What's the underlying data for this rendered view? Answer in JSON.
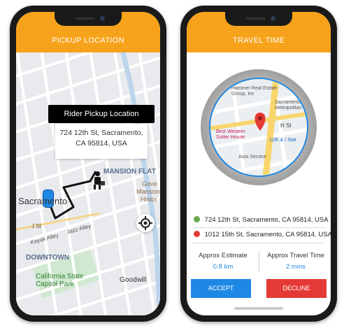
{
  "left_screen": {
    "header_title": "PICKUP LOCATION",
    "callout": {
      "title": "Rider Pickup Location",
      "address": "724 12th St, Sacramento, CA 95814, USA"
    },
    "map_labels": {
      "mansion_flats": "MANSION FLAT",
      "sacramento": "Sacramento",
      "gove": "Gove",
      "mansion": "Mansion",
      "historic": "Histor",
      "j_st": "J St",
      "jazz_alley": "Jazz Alley",
      "kayak_alley": "Kayak Alley",
      "downtown": "DOWNTOWN",
      "capitol_park": "California State Capitol Park",
      "goodwill": "Goodwill"
    },
    "icons": {
      "car": "car-icon",
      "rider": "rider-icon",
      "locate": "crosshair-icon"
    }
  },
  "right_screen": {
    "header_title": "TRAVEL TIME",
    "map_labels": {
      "hammer": "Hammer Real Estate Group, Inc",
      "metropolitan": "Sacramento Metropolitan",
      "h_st": "H St",
      "best_western": "Best Western Sutter House",
      "twelfth_i": "12th & I Stat",
      "auto_service": "Auto Service"
    },
    "pickup_address": "724 12th St, Sacramento, CA 95814, USA",
    "dropoff_address": "1012 15th St, Sacramento, CA 95814, USA",
    "estimate_label": "Approx Estimate",
    "estimate_value": "0.8 km",
    "travel_time_label": "Approx Travel Time",
    "travel_time_value": "2 mins",
    "accept_label": "ACCEPT",
    "decline_label": "DECLINE",
    "colors": {
      "header": "#f7a21b",
      "accent_blue": "#1e88e5",
      "decline_red": "#e53935",
      "pickup_green": "#6aa84f",
      "dropoff_red": "#e53935"
    }
  }
}
